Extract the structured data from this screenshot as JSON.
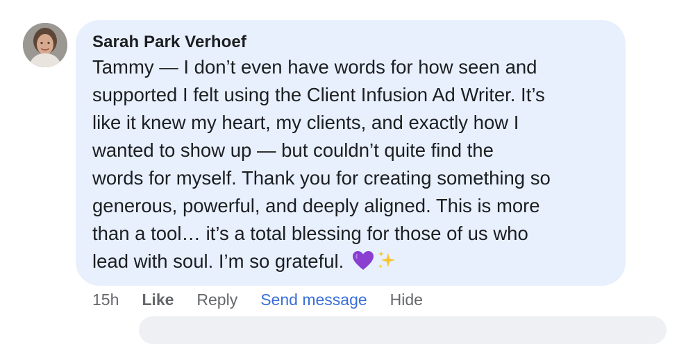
{
  "comment": {
    "author": "Sarah Park Verhoef",
    "lines": [
      "Tammy — I don’t even have words for how seen and",
      "supported I felt using the Client Infusion Ad Writer. It’s",
      "like it knew my heart, my clients, and exactly how I",
      "wanted to show up — but couldn’t quite find the",
      "words for myself. Thank you for creating something so",
      "generous, powerful, and deeply aligned. This is more",
      "than a tool… it’s a total blessing for those of us who",
      "lead with soul. I’m so grateful."
    ],
    "emojis": [
      "purple-heart-icon",
      "sparkles-icon"
    ]
  },
  "actions": {
    "time": "15h",
    "like": "Like",
    "reply": "Reply",
    "send_message": "Send message",
    "hide": "Hide"
  },
  "colors": {
    "bubble": "#e8f0fd",
    "text": "#1c1e21",
    "meta": "#65676b",
    "link": "#3a6fd8",
    "heart": "#8a3fd1",
    "sparkle": "#f7c531"
  }
}
